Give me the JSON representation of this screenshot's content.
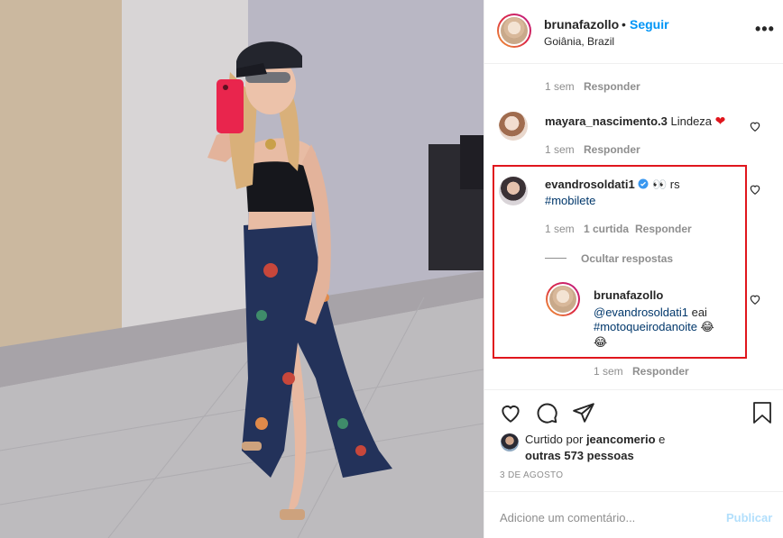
{
  "header": {
    "username": "brunafazollo",
    "dot": "•",
    "follow_label": "Seguir",
    "location": "Goiânia, Brazil",
    "more": "•••"
  },
  "comments": {
    "top_meta": {
      "time": "1 sem",
      "reply": "Responder"
    },
    "mayara": {
      "username": "mayara_nascimento.3",
      "text": "Lindeza",
      "emoji": "❤",
      "time": "1 sem",
      "reply": "Responder"
    },
    "evandro": {
      "username": "evandrosoldati1",
      "text_after_emoji": "rs",
      "emoji": "👀",
      "hashtag": "#mobilete",
      "time": "1 sem",
      "likes": "1 curtida",
      "reply": "Responder",
      "hide_replies": "Ocultar respostas"
    },
    "bruna_reply": {
      "username": "brunafazollo",
      "mention": "@evandrosoldati1",
      "text": " eai",
      "hashtag": "#motoqueirodanoite",
      "emoji": "😂",
      "time": "1 sem",
      "reply": "Responder"
    }
  },
  "actions": {
    "liked_by_prefix": "Curtido por",
    "liked_by_user": "jeancomerio",
    "liked_by_and": "e",
    "others": "outras 573 pessoas",
    "date": "3 DE AGOSTO"
  },
  "add_comment": {
    "placeholder": "Adicione um comentário...",
    "publish": "Publicar"
  },
  "colors": {
    "accent": "#0095f6",
    "highlight_box": "#e0161d",
    "hashtag": "#00376b",
    "muted": "#8e8e8e"
  }
}
